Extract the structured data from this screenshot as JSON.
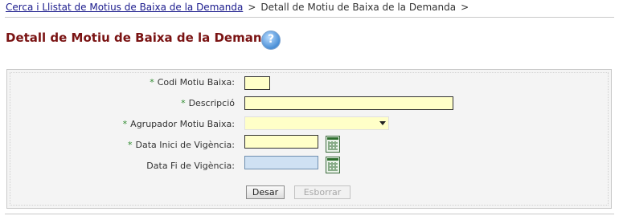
{
  "breadcrumb": {
    "link": "Cerca i Llistat de Motius de Baixa de la Demanda",
    "separator": ">",
    "current": "Detall de Motiu de Baixa de la Demanda",
    "trailing_separator": ">"
  },
  "page": {
    "title": "Detall de Motiu de Baixa de la Demanda",
    "help_glyph": "?"
  },
  "form": {
    "required_marker": "*",
    "fields": {
      "codi": {
        "label": "Codi Motiu Baixa:",
        "value": "",
        "required": true
      },
      "descripcio": {
        "label": "Descripció",
        "value": "",
        "required": true
      },
      "agrupador": {
        "label": "Agrupador Motiu Baixa:",
        "value": "",
        "required": true
      },
      "data_inici": {
        "label": "Data Inici de Vigència:",
        "value": "",
        "required": true
      },
      "data_fi": {
        "label": "Data Fi de Vigència:",
        "value": "",
        "required": false
      }
    },
    "buttons": {
      "save": "Desar",
      "delete": "Esborrar"
    }
  },
  "icons": {
    "help": "help-icon",
    "calendar": "calendar-icon",
    "dropdown": "chevron-down-icon"
  },
  "colors": {
    "title": "#7a1313",
    "required_marker": "#2d8a2d",
    "input_required_bg": "#ffffc8",
    "input_optional_bg": "#cfe1f3"
  }
}
